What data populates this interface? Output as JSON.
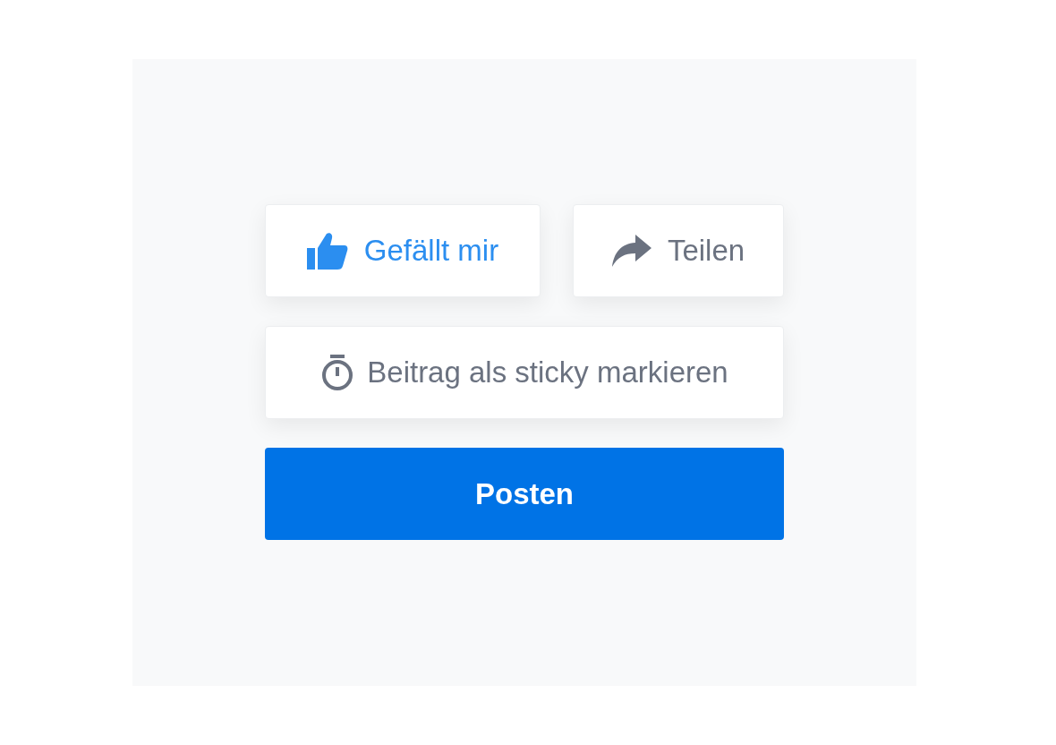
{
  "actions": [
    {
      "label": "Gefällt mir",
      "kind": "like",
      "selected": true
    },
    {
      "label": "Teilen",
      "kind": "share",
      "selected": false
    }
  ],
  "sticky": {
    "label": "Beitrag als sticky markieren"
  },
  "submit": {
    "label": "Posten"
  }
}
